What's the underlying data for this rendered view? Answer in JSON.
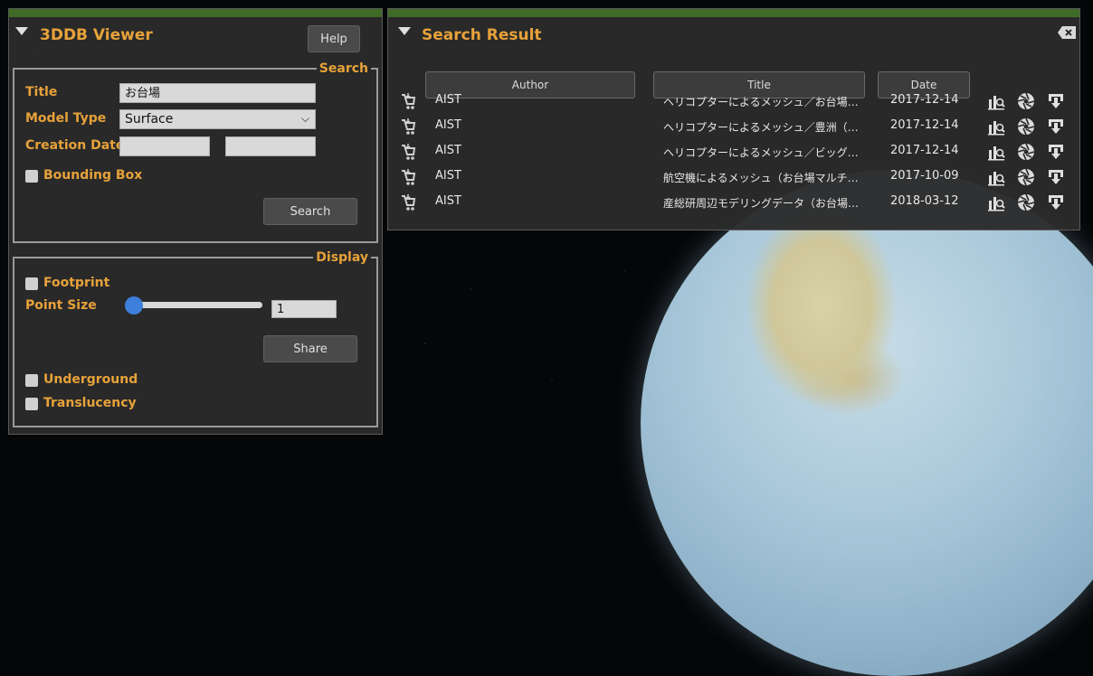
{
  "viewer": {
    "title": "3DDB Viewer",
    "help_label": "Help",
    "search_legend": "Search",
    "title_label": "Title",
    "title_value": "お台場",
    "model_type_label": "Model Type",
    "model_type_value": "Surface",
    "creation_date_label": "Creation Date",
    "bounding_box_label": "Bounding Box",
    "search_button": "Search",
    "display_legend": "Display",
    "footprint_label": "Footprint",
    "point_size_label": "Point Size",
    "point_size_value": "1",
    "share_button": "Share",
    "underground_label": "Underground",
    "translucency_label": "Translucency"
  },
  "results": {
    "title": "Search Result",
    "columns": {
      "author": "Author",
      "title": "Title",
      "date": "Date"
    },
    "rows": [
      {
        "author": "AIST",
        "title": "ヘリコプターによるメッシュ／お台場…",
        "date": "2017-12-14"
      },
      {
        "author": "AIST",
        "title": "ヘリコプターによるメッシュ／豊洲（…",
        "date": "2017-12-14"
      },
      {
        "author": "AIST",
        "title": "ヘリコプターによるメッシュ／ビッグ…",
        "date": "2017-12-14"
      },
      {
        "author": "AIST",
        "title": "航空機によるメッシュ（お台場マルチ…",
        "date": "2017-10-09"
      },
      {
        "author": "AIST",
        "title": "産総研周辺モデリングデータ（お台場…",
        "date": "2018-03-12"
      }
    ]
  },
  "colors": {
    "accent": "#e7a23a",
    "header_bar": "#3f6b27",
    "slider_knob": "#3e7fdc"
  }
}
